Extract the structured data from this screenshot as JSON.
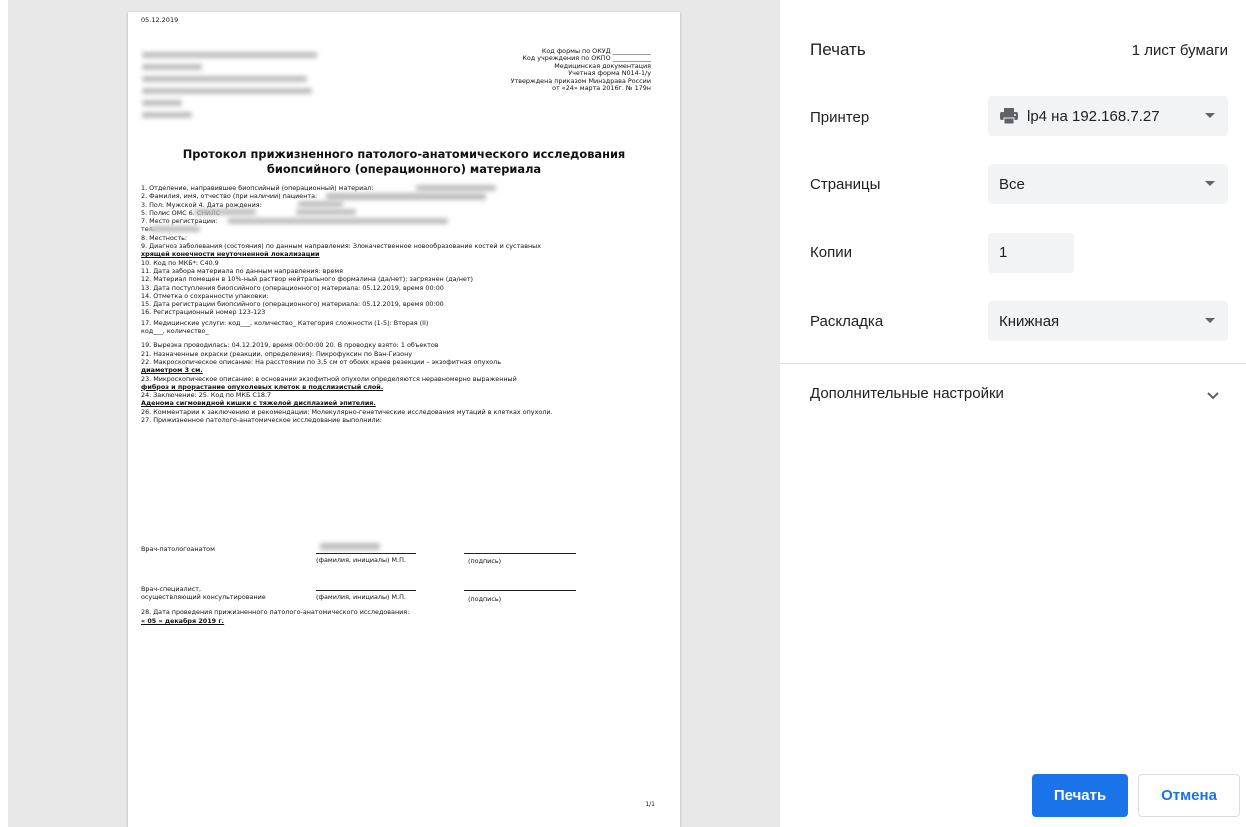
{
  "preview": {
    "date": "05.12.2019",
    "form_info": [
      "Код формы по ОКУД ____________",
      "Код учреждения по ОКПО ____________",
      "Медицинская документация",
      "Учетная форма N014-1/у",
      "Утверждена приказом Минздрава России",
      "от «24» марта 2016г. № 179н"
    ],
    "title_line1": "Протокол прижизненного патолого-анатомического исследования",
    "title_line2": "биопсийного (операционного) материала",
    "lines": [
      "1. Отделение, направившее биопсийный (операционный) материал:",
      "2. Фамилия, имя, отчество (при наличии) пациента:",
      "3. Пол: Мужской  4. Дата рождения:",
      "5. Полис ОМС                          6. СНИЛС",
      "7. Место регистрации:",
      "тел.",
      "8. Местность:",
      "9. Диагноз заболевания (состояния) по данным направления: Злокачественное новообразование костей и суставных",
      "хрящей конечности неуточненной локализации",
      "10. Код по МКБ*: C40.9",
      "11. Дата забора материала по данным направления: время",
      "12. Материал помещен в 10%-ный раствор нейтрального формалина (да/нет): загрязнен (да/нет)",
      "13. Дата поступления биопсийного (операционного) материала: 05.12.2019, время 00:00",
      "14. Отметка о сохранности упаковки:",
      "15. Дата регистрации биопсийного (операционного) материала: 05.12.2019, время 00:00",
      "16. Регистрационный номер 123-123",
      "17. Медицинские услуги:          код___, количество_                Категория сложности (1-5): Вторая (II)",
      "                                            код___, количество_",
      "19. Вырезка проводилась: 04.12.2019, время 00:00:00  20. В проводку взято: 1 объектов",
      "21. Назначенные окраски (реакции, определения): Пикрофуксин по Ван-Гизону",
      "22. Макроскопическое описание:  На расстоянии по 3,5 см от обоих краев резекции – экзофитная опухоль",
      "диаметром 3 см.",
      "23. Микроскопическое описание:  в основании экзофитной опухоли определяются неравномерно выраженный",
      "фиброз и прорастание опухолевых клеток в подслизистый слой.",
      "24. Заключение:                                                          25. Код по МКБ C18.7",
      "Аденома сигмовидной кишки с тяжелой дисплазией эпителия.",
      "26. Комментарии к заключению и рекомендации:  Молекулярно-генетические исследования мутаций в клетках опухоли.",
      "27. Прижизненное патолого-анатомическое исследование выполнили:"
    ],
    "pathologist_label": "Врач-патологоанатом",
    "specialist_label1": "Врач-специалист,",
    "specialist_label2": "осуществляющий консультирование",
    "fio_caption": "(фамилия, инициалы) М.П.",
    "signature_caption": "(подпись)",
    "line28": "28. Дата проведения прижизненного патолого-анатомического исследования:",
    "line28_date": "« 05 » декабря 2019 г.",
    "page_number": "1/1"
  },
  "panel": {
    "title": "Печать",
    "sheets": "1 лист бумаги",
    "printer_label": "Принтер",
    "printer_value": "lp4 на 192.168.7.27",
    "pages_label": "Страницы",
    "pages_value": "Все",
    "copies_label": "Копии",
    "copies_value": "1",
    "layout_label": "Раскладка",
    "layout_value": "Книжная",
    "more_settings": "Дополнительные настройки",
    "print_button": "Печать",
    "cancel_button": "Отмена"
  },
  "colors": {
    "accent": "#1a73e8",
    "field_bg": "#f1f3f4",
    "preview_bg": "#e8e8e8"
  }
}
